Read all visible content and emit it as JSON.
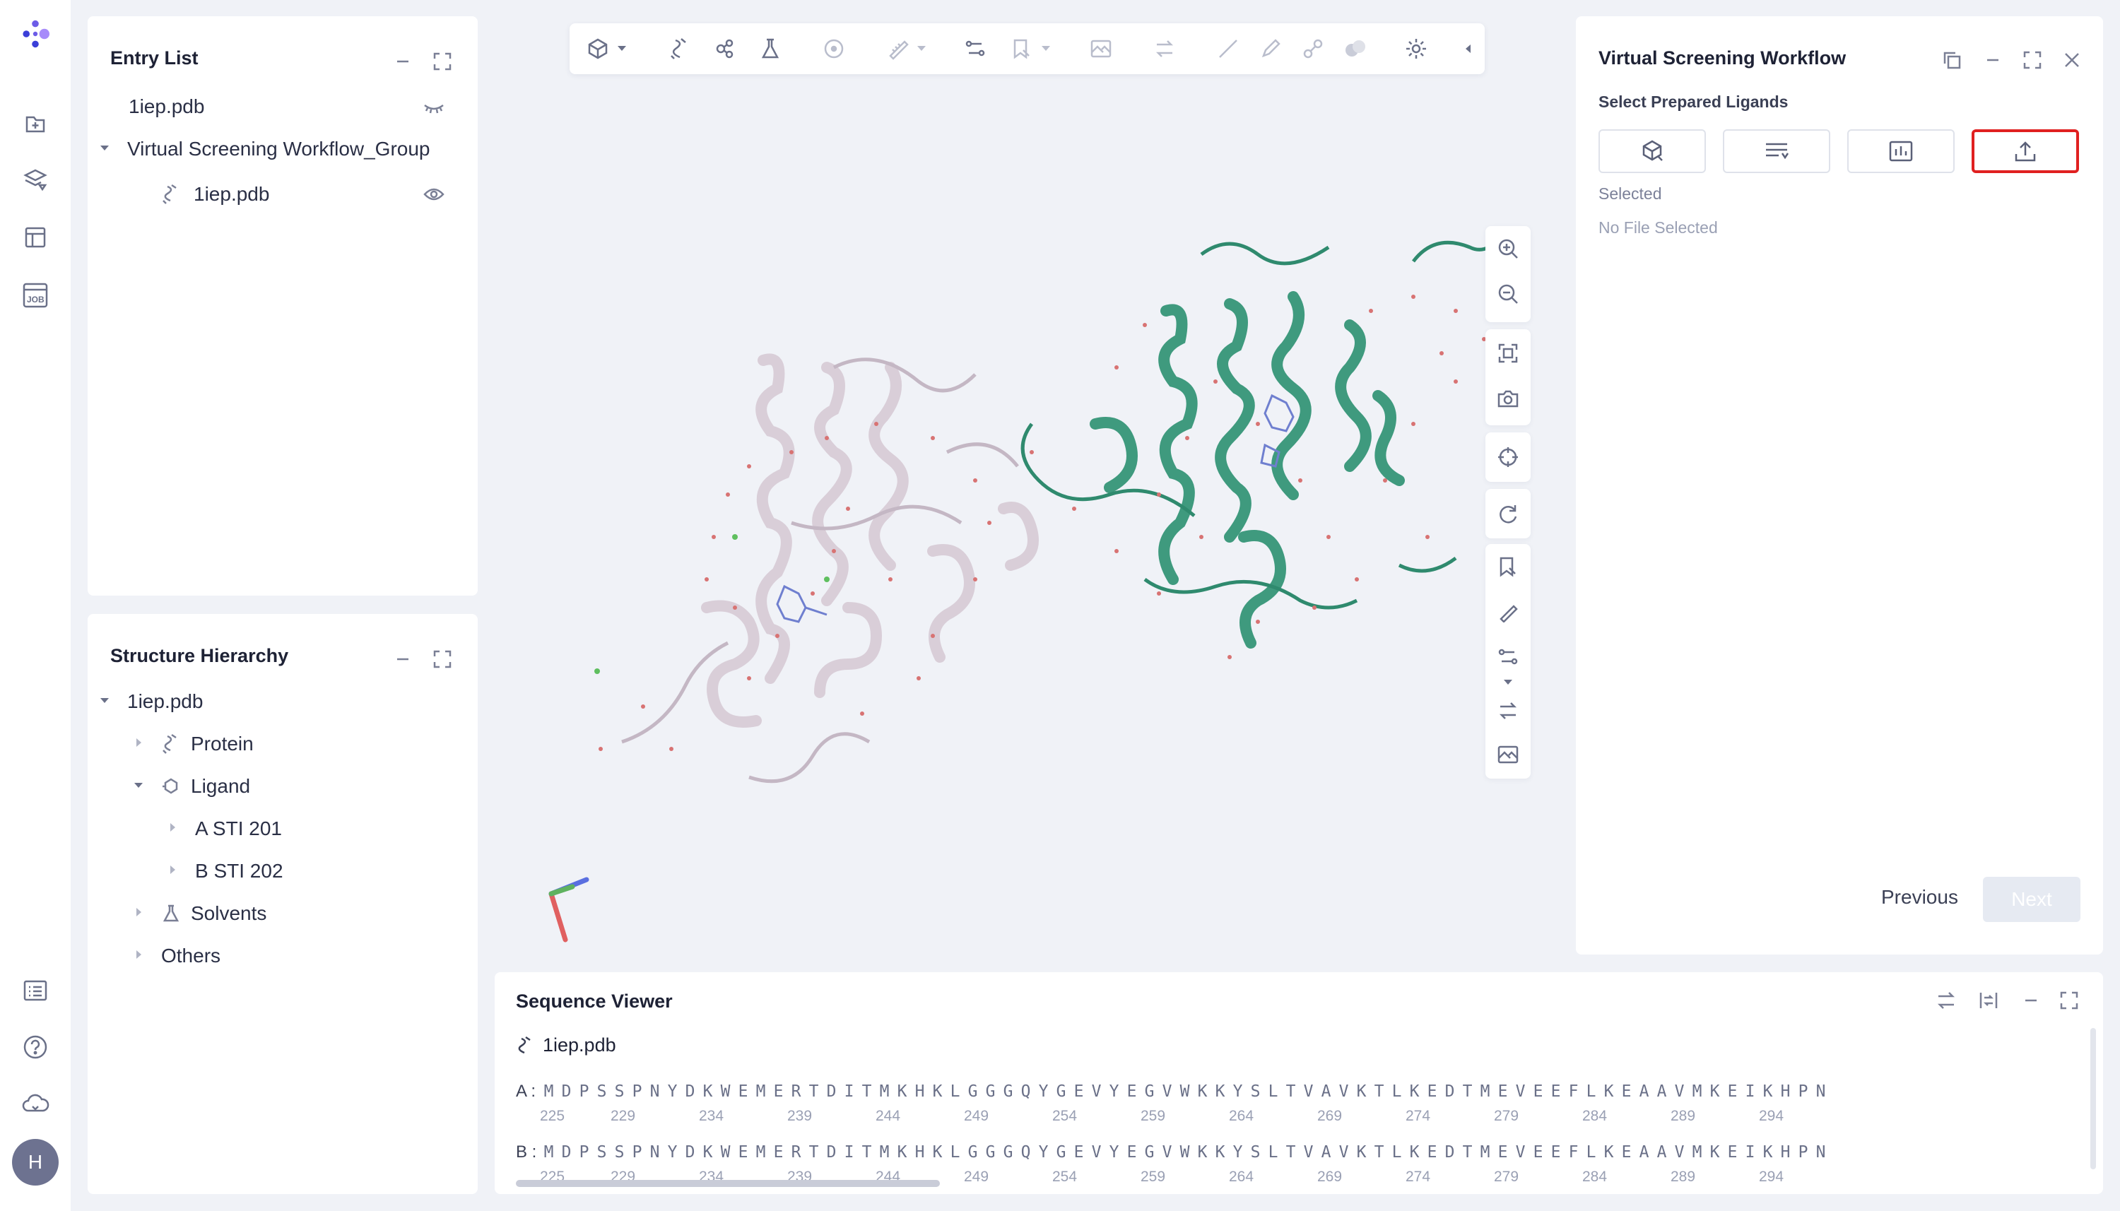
{
  "app": {
    "logo": "molecule-logo",
    "user_initial": "H"
  },
  "rail": {
    "top_icons": [
      "import-file-icon",
      "layers-icon",
      "table-icon",
      "job-icon"
    ],
    "bottom_icons": [
      "task-list-icon",
      "help-icon",
      "cloud-icon"
    ]
  },
  "entry_list": {
    "title": "Entry List",
    "items": [
      {
        "label": "1iep.pdb",
        "visibility": "hidden"
      },
      {
        "label": "Virtual Screening Workflow_Group",
        "expanded": true
      },
      {
        "label": "1iep.pdb",
        "visibility": "visible"
      }
    ]
  },
  "structure_hierarchy": {
    "title": "Structure Hierarchy",
    "root": "1iep.pdb",
    "protein": "Protein",
    "ligand": "Ligand",
    "ligand_children": [
      "A STI 201",
      "B STI 202"
    ],
    "solvents": "Solvents",
    "others": "Others"
  },
  "viewer_toolbar": {
    "tools": [
      "cube-icon",
      "ribbon-icon",
      "molecule-icon",
      "flask-icon",
      "select-icon",
      "measure-icon",
      "path-icon",
      "bookmark-icon",
      "image-icon",
      "swap-icon",
      "line-icon",
      "pencil-icon",
      "link-icon",
      "surface-icon",
      "gear-icon"
    ]
  },
  "viewer_side": {
    "tools": [
      "zoom-in-icon",
      "zoom-out-icon",
      "fit-icon",
      "camera-icon",
      "center-icon",
      "rotate-icon",
      "bookmark-icon",
      "measure-icon",
      "path-icon",
      "swap-icon",
      "image-icon"
    ]
  },
  "workflow": {
    "title": "Virtual Screening Workflow",
    "subtitle": "Select Prepared Ligands",
    "buttons": [
      "ligand-cube-icon",
      "list-icon",
      "chart-icon",
      "upload-icon"
    ],
    "selected_label": "Selected",
    "selected_value": "No File Selected",
    "previous": "Previous",
    "next": "Next"
  },
  "sequence_viewer": {
    "title": "Sequence Viewer",
    "file": "1iep.pdb",
    "chains": [
      {
        "label": "A :",
        "residues": "MDPSSPNYDKWEMERTDITMKHKLGGGQYGEVYEGVWKKYSLTVAVKTLKEDTMEVEEFLKEAAVMKEIKHPN"
      },
      {
        "label": "B :",
        "residues": "MDPSSPNYDKWEMERTDITMKHKLGGGQYGEVYEGVWKKYSLTVAVKTLKEDTMEVEEFLKEAAVMKEIKHPN"
      }
    ],
    "numbers": [
      "225",
      "229",
      "234",
      "239",
      "244",
      "249",
      "254",
      "259",
      "264",
      "269",
      "274",
      "279",
      "284",
      "289",
      "294"
    ]
  },
  "colors": {
    "accent": "#6c5ce7",
    "highlight": "#e02020",
    "chain_a": "#d8ccd6",
    "chain_b": "#3f9a7e"
  }
}
